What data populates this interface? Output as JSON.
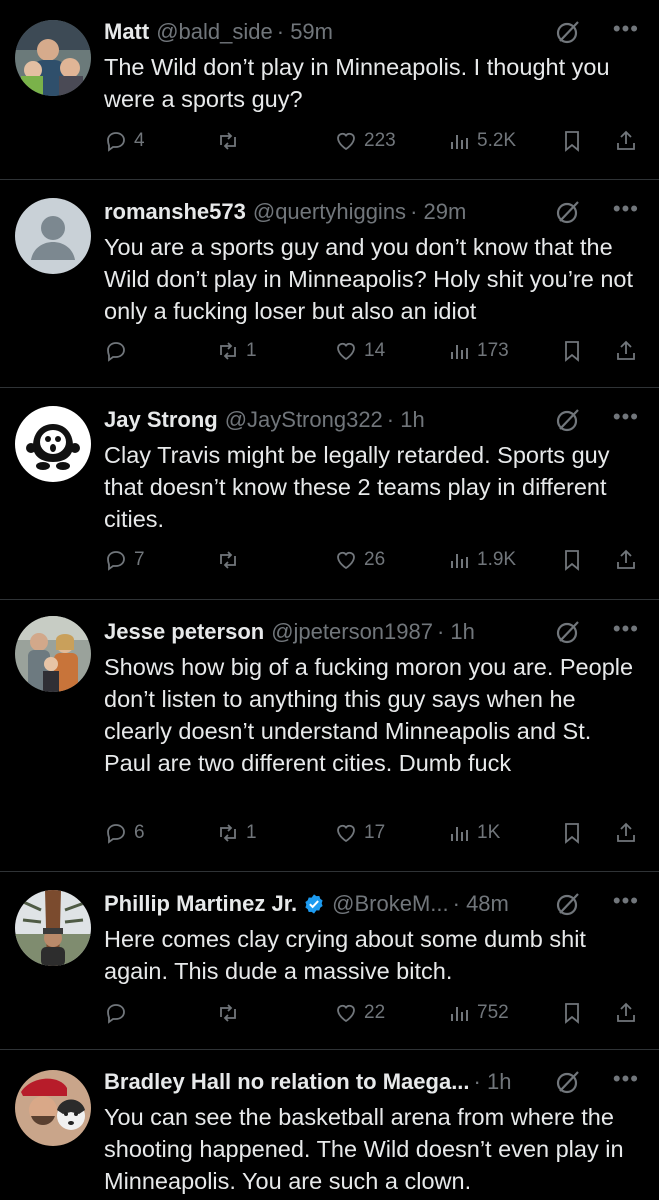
{
  "colors": {
    "background": "#000000",
    "text_primary": "#e7e9ea",
    "text_secondary": "#71767b",
    "divider": "#2f3336",
    "verified": "#1d9bf0"
  },
  "tweets": [
    {
      "name": "Matt",
      "handle": "@bald_side",
      "time": "· 59m",
      "text": "The Wild don’t play in Minneapolis. I thought you were a sports guy?",
      "replies": "4",
      "reposts": "",
      "likes": "223",
      "views": "5.2K",
      "verified": false
    },
    {
      "name": "romanshe573",
      "handle": "@quertyhiggins",
      "time": "· 29m",
      "text": "You are a sports guy and you don’t know that the Wild don’t play in Minneapolis? Holy shit you’re not only a fucking loser but also an idiot",
      "replies": "",
      "reposts": "1",
      "likes": "14",
      "views": "173",
      "verified": false
    },
    {
      "name": "Jay Strong",
      "handle": "@JayStrong322",
      "time": "· 1h",
      "text": "Clay Travis might be legally retarded. Sports guy that doesn’t know these 2 teams play in different cities.",
      "replies": "7",
      "reposts": "",
      "likes": "26",
      "views": "1.9K",
      "verified": false
    },
    {
      "name": "Jesse peterson",
      "handle": "@jpeterson1987",
      "time": "· 1h",
      "text": "Shows how big of a fucking moron you are. People don’t listen to anything this guy says when he clearly doesn’t understand Minneapolis and St. Paul are two different cities. Dumb fuck",
      "replies": "6",
      "reposts": "1",
      "likes": "17",
      "views": "1K",
      "verified": false
    },
    {
      "name": "Phillip Martinez Jr.",
      "handle": "@BrokeM...",
      "time": "· 48m",
      "text": "Here comes clay crying about some dumb shit again. This dude a massive bitch.",
      "replies": "",
      "reposts": "",
      "likes": "22",
      "views": "752",
      "verified": true
    },
    {
      "name": "Bradley Hall no relation to Maega...",
      "handle": "",
      "time": "· 1h",
      "text": "You can see the basketball arena from where the shooting happened. The Wild doesn’t even play in Minneapolis. You are such a clown.",
      "replies": "",
      "reposts": "",
      "likes": "",
      "views": "",
      "verified": false
    }
  ],
  "icons": {
    "reply": "reply-icon",
    "repost": "repost-icon",
    "like": "heart-icon",
    "views": "views-icon",
    "bookmark": "bookmark-icon",
    "share": "share-icon",
    "grok": "grok-icon",
    "more": "more-icon"
  }
}
